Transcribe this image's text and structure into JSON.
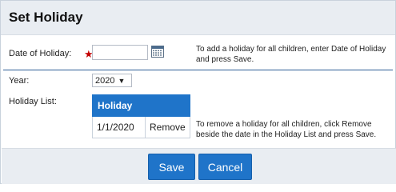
{
  "header": {
    "title": "Set Holiday"
  },
  "form": {
    "date_label": "Date of Holiday:",
    "required_mark": "★",
    "date_value": "",
    "date_help_1": "To add a holiday for all children, enter Date of Holiday",
    "date_help_2": "and press Save.",
    "year_label": "Year:",
    "year_value": "2020",
    "holiday_list_label": "Holiday List:"
  },
  "table": {
    "headers": [
      "Holiday",
      ""
    ],
    "rows": [
      {
        "date": "1/1/2020",
        "action": "Remove"
      }
    ]
  },
  "remove_help_1": "To remove a holiday for all children, click Remove",
  "remove_help_2": "beside the date in the Holiday List and press Save.",
  "footer": {
    "save_label": "Save",
    "cancel_label": "Cancel"
  },
  "icons": {
    "calendar": "calendar-icon",
    "dropdown": "chevron-down-icon"
  },
  "colors": {
    "accent": "#1f74c9",
    "required": "#c40000",
    "divider": "#2c5d97"
  }
}
